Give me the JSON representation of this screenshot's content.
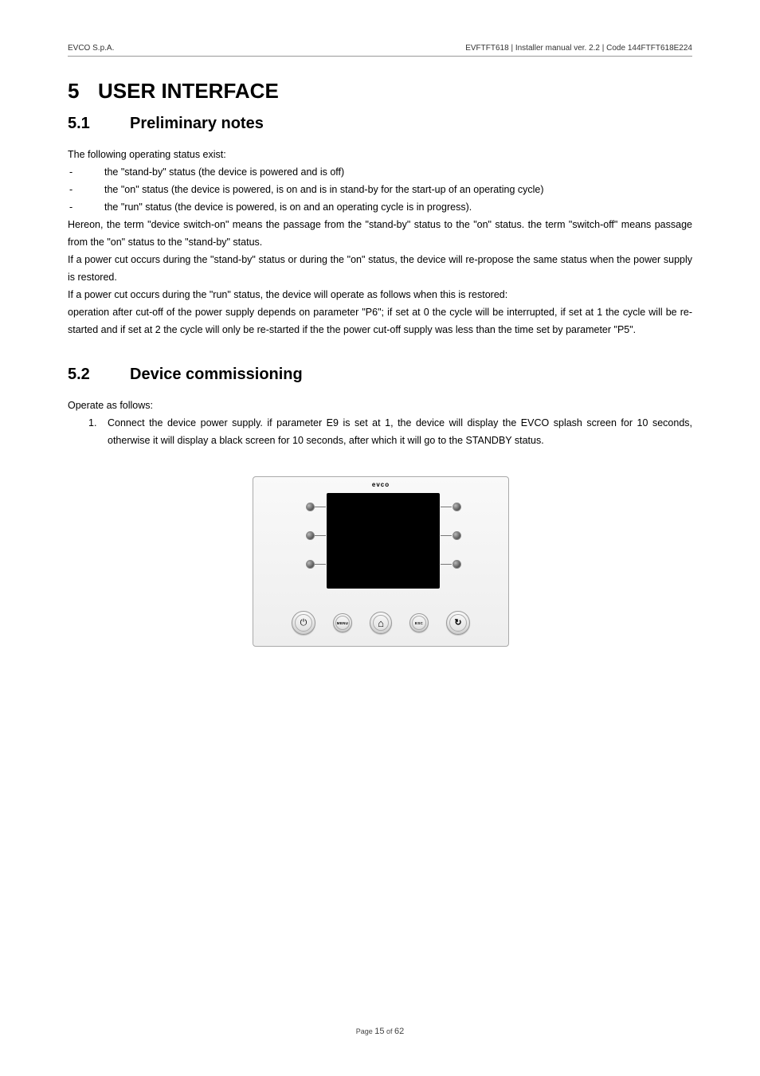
{
  "header": {
    "left": "EVCO S.p.A.",
    "right": "EVFTFT618 | Installer manual ver. 2.2 | Code 144FTFT618E224"
  },
  "section5": {
    "num": "5",
    "title": "USER INTERFACE"
  },
  "section51": {
    "num": "5.1",
    "title": "Preliminary notes",
    "intro": "The following operating status exist:",
    "statuses": [
      "the \"stand-by\" status (the device is powered and is off)",
      "the \"on\" status (the device is powered, is on and is in stand-by for the start-up of an operating cycle)",
      "the \"run\" status (the device is powered, is on and an operating cycle is in progress)."
    ],
    "p1": "Hereon, the term \"device switch-on\" means the passage from the \"stand-by\" status to the \"on\" status. the term \"switch-off\" means passage from the \"on\" status to the \"stand-by\" status.",
    "p2": "If a power cut occurs during the \"stand-by\" status or during the \"on\" status, the device will re-propose the same status when the power supply is restored.",
    "p3": "If a power cut occurs during the \"run\" status, the device will operate as follows when this is restored:",
    "p4": "operation after cut-off of the power supply depends on parameter \"P6\"; if set at 0 the cycle will be interrupted, if set at 1 the cycle will be re-started and if set at 2 the cycle will only be re-started if the the power cut-off supply was less than the time set by parameter \"P5\"."
  },
  "section52": {
    "num": "5.2",
    "title": "Device commissioning",
    "intro": "Operate as follows:",
    "item1_marker": "1.",
    "item1": "Connect the device power supply. if parameter E9 is set at 1, the device will display the EVCO splash screen for 10 seconds, otherwise it will display a black screen for 10 seconds, after which it will go to the STANDBY status."
  },
  "device": {
    "logo": "evco",
    "buttons": {
      "power": "⏻",
      "menu": "MENU",
      "home": "⌂",
      "esc": "ESC",
      "rotate": "↻"
    }
  },
  "footer": {
    "prefix": "Page ",
    "current": "15",
    "mid": " of ",
    "total": "62"
  }
}
